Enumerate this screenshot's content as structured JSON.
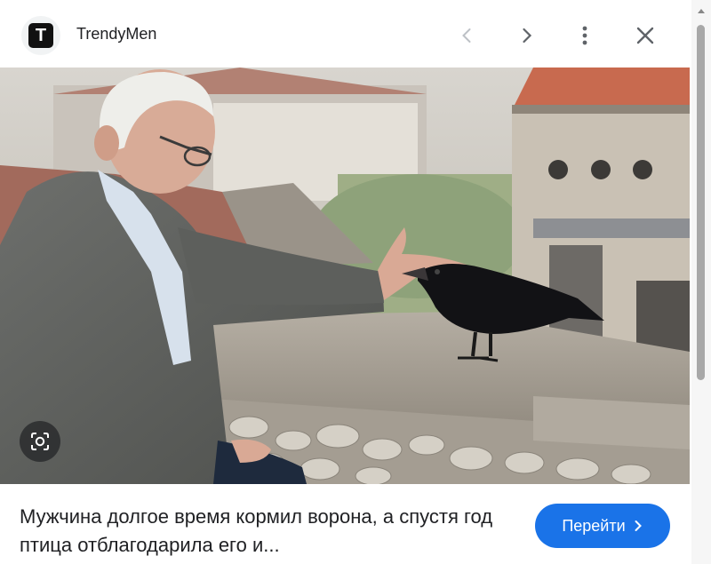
{
  "header": {
    "site_logo_letter": "T",
    "site_name": "TrendyMen",
    "icons": [
      "chevron-left-icon",
      "chevron-right-icon",
      "more-vert-icon",
      "close-icon"
    ]
  },
  "image": {
    "subject": "photo",
    "lens_icon": "lens-search-icon"
  },
  "caption": {
    "text": "Мужчина долгое время кормил ворона, а спустя год птица отблагодарила его и..."
  },
  "action": {
    "button_label": "Перейти",
    "button_icon": "chevron-right-icon"
  },
  "colors": {
    "accent": "#1a73e8",
    "text": "#202124",
    "icon": "#5f6368"
  }
}
